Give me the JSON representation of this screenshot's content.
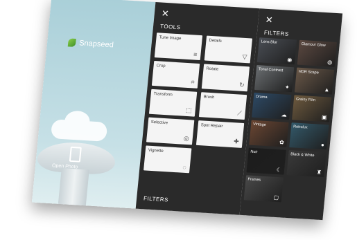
{
  "onboarding": {
    "app_name": "Snapseed",
    "open_photo": "Open Photo"
  },
  "tools_panel": {
    "close": "✕",
    "title": "TOOLS",
    "footer": "FILTERS",
    "items": [
      {
        "label": "Tune Image",
        "icon": "sliders-icon",
        "glyph": "≡"
      },
      {
        "label": "Details",
        "icon": "triangle-icon",
        "glyph": "▽"
      },
      {
        "label": "Crop",
        "icon": "crop-icon",
        "glyph": "⌗"
      },
      {
        "label": "Rotate",
        "icon": "rotate-icon",
        "glyph": "↻"
      },
      {
        "label": "Transform",
        "icon": "transform-icon",
        "glyph": "⬚"
      },
      {
        "label": "Brush",
        "icon": "brush-icon",
        "glyph": "⟋"
      },
      {
        "label": "Selective",
        "icon": "target-icon",
        "glyph": "◎"
      },
      {
        "label": "Spot Repair",
        "icon": "bandage-icon",
        "glyph": "✚"
      },
      {
        "label": "Vignette",
        "icon": "vignette-icon",
        "glyph": "◌"
      }
    ]
  },
  "filters_panel": {
    "close": "✕",
    "title": "FILTERS",
    "items": [
      {
        "label": "Lens Blur",
        "icon": "lens-icon",
        "glyph": "◉",
        "color": "#4a4e55"
      },
      {
        "label": "Glamour Glow",
        "icon": "eye-icon",
        "glyph": "◍",
        "color": "#5b4840"
      },
      {
        "label": "Tonal Contrast",
        "icon": "contrast-icon",
        "glyph": "✦",
        "color": "#6b6f72"
      },
      {
        "label": "HDR Scape",
        "icon": "mountain-icon",
        "glyph": "▲",
        "color": "#6a5848"
      },
      {
        "label": "Drama",
        "icon": "cloud-icon",
        "glyph": "☁",
        "color": "#2d4a66"
      },
      {
        "label": "Grainy Film",
        "icon": "film-icon",
        "glyph": "▣",
        "color": "#6e5a3e"
      },
      {
        "label": "Vintage",
        "icon": "flower-icon",
        "glyph": "✿",
        "color": "#6b4632"
      },
      {
        "label": "Retrolux",
        "icon": "bulb-icon",
        "glyph": "●",
        "color": "#33596a"
      },
      {
        "label": "Noir",
        "icon": "moon-icon",
        "glyph": "☾",
        "color": "#1c1c1c"
      },
      {
        "label": "Black & White",
        "icon": "tower-icon",
        "glyph": "♜",
        "color": "#3a3a3a"
      },
      {
        "label": "Frames",
        "icon": "frame-icon",
        "glyph": "▢",
        "color": "#4a4a4a"
      }
    ]
  }
}
